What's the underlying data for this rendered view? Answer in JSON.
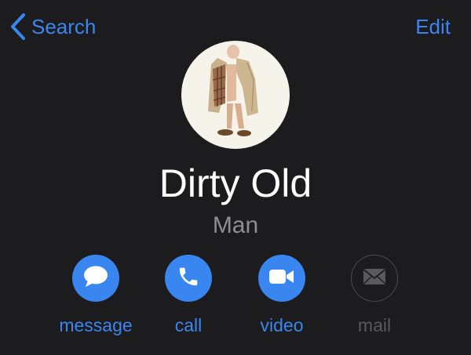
{
  "nav": {
    "back_label": "Search",
    "edit_label": "Edit"
  },
  "contact": {
    "first_name": "Dirty Old",
    "last_name": "Man",
    "avatar": "elderly man in open trench coat photo"
  },
  "actions": [
    {
      "label": "message",
      "icon": "message-bubble-icon",
      "enabled": true
    },
    {
      "label": "call",
      "icon": "phone-icon",
      "enabled": true
    },
    {
      "label": "video",
      "icon": "video-camera-icon",
      "enabled": true
    },
    {
      "label": "mail",
      "icon": "envelope-icon",
      "enabled": false
    }
  ],
  "colors": {
    "background": "#1c1c1e",
    "accent": "#3a86f0",
    "primary_text": "#ffffff",
    "secondary_text": "#8e8e93",
    "disabled": "#5a5a5e"
  }
}
